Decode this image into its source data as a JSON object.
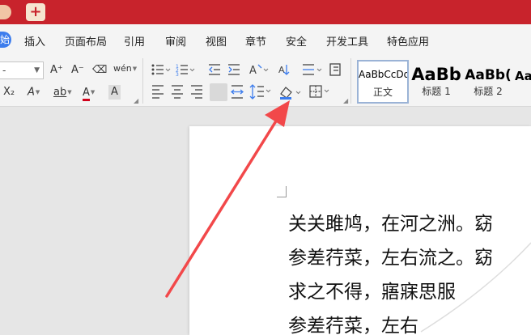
{
  "titlebar": {
    "new_tab_icon": "+"
  },
  "menu": {
    "start_label": "开始",
    "items": [
      "插入",
      "页面布局",
      "引用",
      "审阅",
      "视图",
      "章节",
      "安全",
      "开发工具",
      "特色应用"
    ]
  },
  "ribbon": {
    "font_size_value": "-",
    "grow_font": "A⁺",
    "shrink_font": "A⁻",
    "clear_format": "⌫",
    "phonetic": "wén",
    "subscript": "X₂",
    "text_effect": "A",
    "highlight": "ab",
    "font_color": "A",
    "char_shading": "A"
  },
  "styles": [
    {
      "preview": "AaBbCcDd",
      "name": "正文",
      "selected": true
    },
    {
      "preview": "AaBb",
      "name": "标题 1"
    },
    {
      "preview": "AaBb(",
      "name": "标题 2"
    },
    {
      "preview": "Aa",
      "name": ""
    }
  ],
  "document": {
    "lines": [
      "关关雎鸠，在河之洲。窈",
      "参差荇菜，左右流之。窈",
      "求之不得，寤寐思服",
      "参差荇菜，左右"
    ]
  },
  "colors": {
    "title_red": "#c8232c",
    "accent_blue": "#3d7ded",
    "arrow": "#f2484a",
    "font_color_red": "#d0021b"
  }
}
